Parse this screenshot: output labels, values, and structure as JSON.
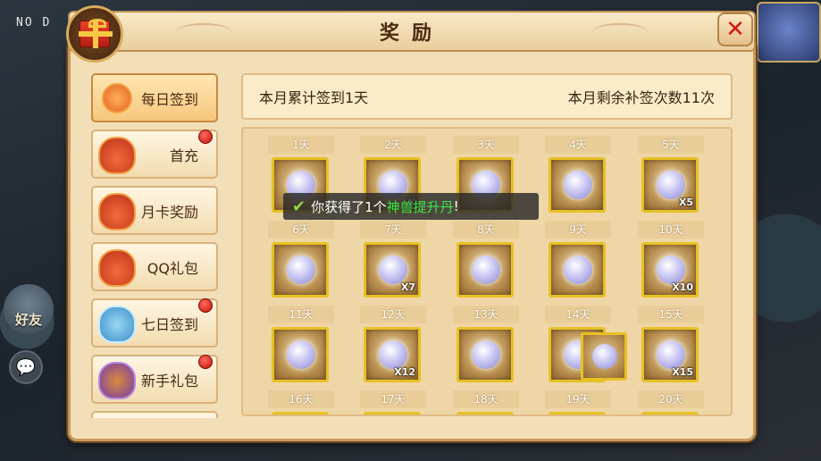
{
  "hud": {
    "corner_text": "NO D",
    "friend_label": "好友",
    "chat_icon": "chat-bubble-icon"
  },
  "window": {
    "title": "奖励",
    "close_symbol": "✕"
  },
  "menu": {
    "items": [
      {
        "label": "每日签到",
        "icon": "coin-bag-icon",
        "active": true,
        "badge": false
      },
      {
        "label": "首充",
        "icon": "gift-bag-icon",
        "active": false,
        "badge": true
      },
      {
        "label": "月卡奖励",
        "icon": "gift-bag-icon",
        "active": false,
        "badge": false
      },
      {
        "label": "QQ礼包",
        "icon": "gift-bag-icon",
        "active": false,
        "badge": false
      },
      {
        "label": "七日签到",
        "icon": "scroll-icon",
        "active": false,
        "badge": true
      },
      {
        "label": "新手礼包",
        "icon": "treasure-icon",
        "active": false,
        "badge": true
      }
    ]
  },
  "signin": {
    "cumulative": "本月累计签到1天",
    "remaining": "本月剩余补签次数11次"
  },
  "days": [
    {
      "label": "1天",
      "qty": ""
    },
    {
      "label": "2天",
      "qty": "X"
    },
    {
      "label": "3天",
      "qty": ""
    },
    {
      "label": "4天",
      "qty": ""
    },
    {
      "label": "5天",
      "qty": "X5"
    },
    {
      "label": "6天",
      "qty": ""
    },
    {
      "label": "7天",
      "qty": "X7"
    },
    {
      "label": "8天",
      "qty": ""
    },
    {
      "label": "9天",
      "qty": ""
    },
    {
      "label": "10天",
      "qty": "X10"
    },
    {
      "label": "11天",
      "qty": ""
    },
    {
      "label": "12天",
      "qty": "X12"
    },
    {
      "label": "13天",
      "qty": ""
    },
    {
      "label": "14天",
      "qty": ""
    },
    {
      "label": "15天",
      "qty": "X15"
    },
    {
      "label": "16天",
      "qty": ""
    },
    {
      "label": "17天",
      "qty": ""
    },
    {
      "label": "18天",
      "qty": ""
    },
    {
      "label": "19天",
      "qty": ""
    },
    {
      "label": "20天",
      "qty": ""
    }
  ],
  "toast": {
    "prefix": "你获得了1个",
    "item": "神兽提升丹",
    "suffix": "!"
  }
}
